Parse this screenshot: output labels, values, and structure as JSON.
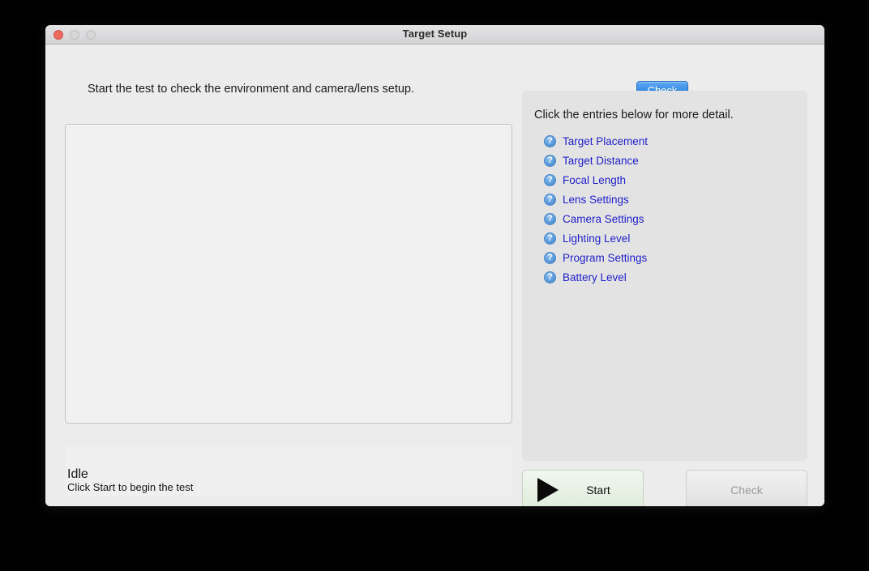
{
  "window": {
    "title": "Target Setup",
    "controls": {
      "close_label": "close",
      "minimize_label": "minimize",
      "zoom_label": "zoom"
    }
  },
  "left": {
    "instruction": "Start the test to check the environment and camera/lens setup.",
    "preview_placeholder": "",
    "status": {
      "state": "Idle",
      "hint": "Click Start to begin the test"
    }
  },
  "right": {
    "tab": {
      "label": "Check",
      "accent_color": "#3d8fe8",
      "selected": true
    },
    "hint": "Click the entries below for more detail.",
    "entries": [
      {
        "icon": "help-circle-icon",
        "label": "Target Placement"
      },
      {
        "icon": "help-circle-icon",
        "label": "Target Distance"
      },
      {
        "icon": "help-circle-icon",
        "label": "Focal Length"
      },
      {
        "icon": "help-circle-icon",
        "label": "Lens Settings"
      },
      {
        "icon": "help-circle-icon",
        "label": "Camera Settings"
      },
      {
        "icon": "help-circle-icon",
        "label": "Lighting Level"
      },
      {
        "icon": "help-circle-icon",
        "label": "Program Settings"
      },
      {
        "icon": "help-circle-icon",
        "label": "Battery Level"
      }
    ],
    "link_color": "#2222cc"
  },
  "buttons": {
    "start": {
      "label": "Start",
      "icon": "play-triangle-icon",
      "enabled": true
    },
    "check": {
      "label": "Check",
      "enabled": false
    }
  }
}
